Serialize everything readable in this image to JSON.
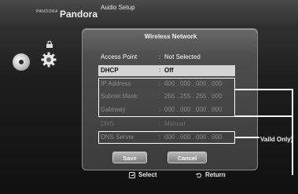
{
  "topbar": {
    "pandora_logo": "PANDORA",
    "pandora_title": "Pandora",
    "audio_setup": "Audio Setup"
  },
  "dialog": {
    "title": "Wireless Network",
    "rows": [
      {
        "label": "Access Point",
        "value": "Not Selected"
      },
      {
        "label": "DHCP",
        "value": "Off"
      },
      {
        "label": "IP Address",
        "value": "000 . 000 . 000 . 000"
      },
      {
        "label": "Subnet Mask",
        "value": "255 . 255 . 255 . 000"
      },
      {
        "label": "Gateway",
        "value": "000 . 000 . 000 . 000"
      },
      {
        "label": "DNS",
        "value": "Manual"
      },
      {
        "label": "DNS Server",
        "value": "000 . 000 . 000 . 000"
      }
    ],
    "colon": ":",
    "save_label": "Save",
    "cancel_label": "Cancel"
  },
  "help": {
    "select_label": "Select",
    "return_label": "Return"
  },
  "annotation": {
    "valid_only": "Vaild Only)"
  },
  "icons": {
    "disc": "disc-icon",
    "gear": "gear-icon",
    "lock": "lock-icon",
    "select": "enter-icon",
    "return": "return-icon"
  }
}
